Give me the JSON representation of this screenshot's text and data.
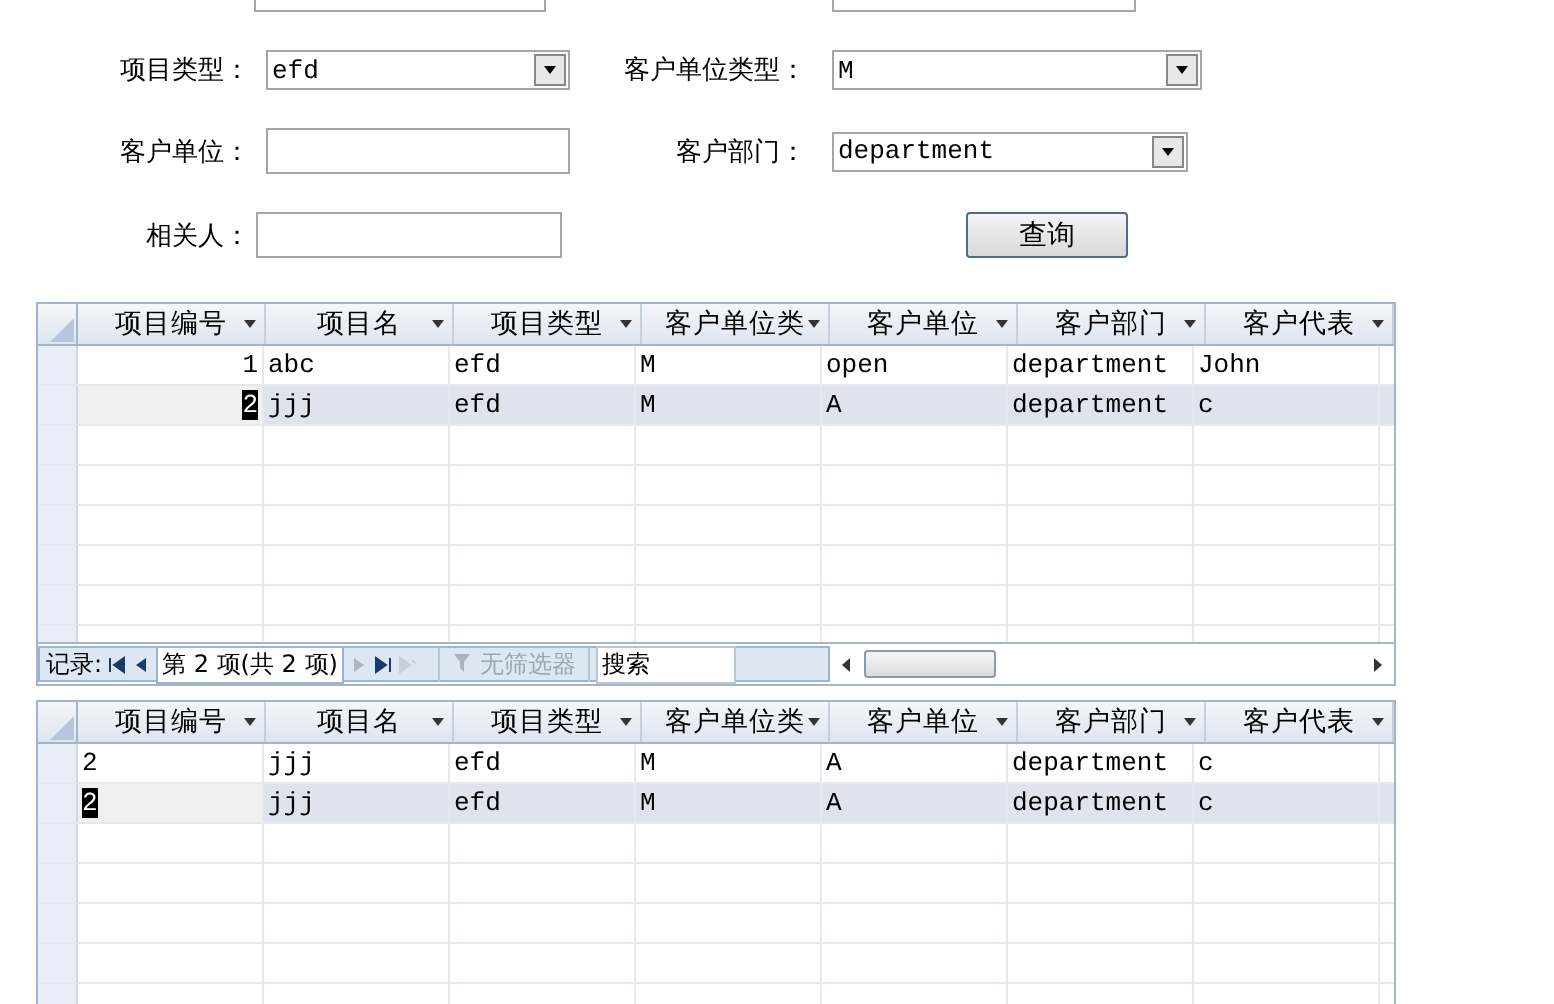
{
  "filters": [
    {
      "kind": "select",
      "label": "项目类型：",
      "value": "efd"
    },
    {
      "kind": "select",
      "label": "客户单位类型：",
      "value": "M"
    },
    {
      "kind": "input",
      "label": "客户单位："
    },
    {
      "kind": "select",
      "label": "客户部门：",
      "value": "department"
    },
    {
      "kind": "input",
      "label": "相关人："
    }
  ],
  "query_button": "查询",
  "grids": [
    {
      "first_column_numeric": true,
      "columns": [
        "项目编号",
        "项目名",
        "项目类型",
        "客户单位类",
        "客户单位",
        "客户部门",
        "客户代表"
      ],
      "rows": [
        {
          "selected": false,
          "cells": [
            "1",
            "abc",
            "efd",
            "M",
            "open",
            "department",
            "John"
          ]
        },
        {
          "selected": true,
          "cells": [
            "2",
            "jjj",
            "efd",
            "M",
            "A",
            "department",
            "c"
          ]
        }
      ],
      "navigator": {
        "label": "记录:",
        "position": "第 2 项(共 2 项)",
        "filter": "无筛选器",
        "search": "搜索"
      }
    },
    {
      "first_column_numeric": false,
      "columns": [
        "项目编号",
        "项目名",
        "项目类型",
        "客户单位类",
        "客户单位",
        "客户部门",
        "客户代表"
      ],
      "rows": [
        {
          "selected": false,
          "cells": [
            "2",
            "jjj",
            "efd",
            "M",
            "A",
            "department",
            "c"
          ]
        },
        {
          "selected": true,
          "cells": [
            "2",
            "jjj",
            "efd",
            "M",
            "A",
            "department",
            "c"
          ]
        }
      ]
    }
  ]
}
